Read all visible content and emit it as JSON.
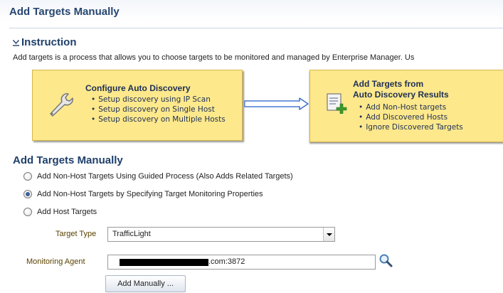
{
  "page": {
    "title": "Add Targets Manually"
  },
  "instruction": {
    "heading": "Instruction",
    "toggle_icon": "collapse-arrow-icon",
    "text": "Add targets is a process that allows you to choose targets to be monitored and managed by Enterprise Manager. Us"
  },
  "workflow": {
    "step1": {
      "icon": "wrench-icon",
      "title": "Configure Auto Discovery",
      "items": [
        "Setup discovery using IP Scan",
        "Setup discovery on Single Host",
        "Setup discovery on Multiple Hosts"
      ]
    },
    "step2": {
      "icon": "add-document-icon",
      "title_line1": "Add Targets from",
      "title_line2": "Auto Discovery Results",
      "items": [
        "Add Non-Host targets",
        "Add Discovered Hosts",
        "Ignore Discovered Targets"
      ]
    },
    "arrow_icon": "right-arrow-icon"
  },
  "manual": {
    "heading": "Add Targets Manually",
    "options": [
      {
        "label": "Add Non-Host Targets Using Guided Process (Also Adds Related Targets)",
        "checked": false
      },
      {
        "label": "Add Non-Host Targets by Specifying Target Monitoring Properties",
        "checked": true
      },
      {
        "label": "Add Host Targets",
        "checked": false
      }
    ],
    "target_type": {
      "label": "Target Type",
      "value": "TrafficLight"
    },
    "monitoring_agent": {
      "label": "Monitoring Agent",
      "value_suffix": ".com:3872",
      "search_icon": "search-icon"
    },
    "add_button": "Add Manually ..."
  },
  "colors": {
    "heading": "#1f3f6b",
    "box_fill": "#fde88c",
    "box_border": "#d8b54a",
    "arrow": "#3a6fd0",
    "field_label": "#5a4200"
  }
}
